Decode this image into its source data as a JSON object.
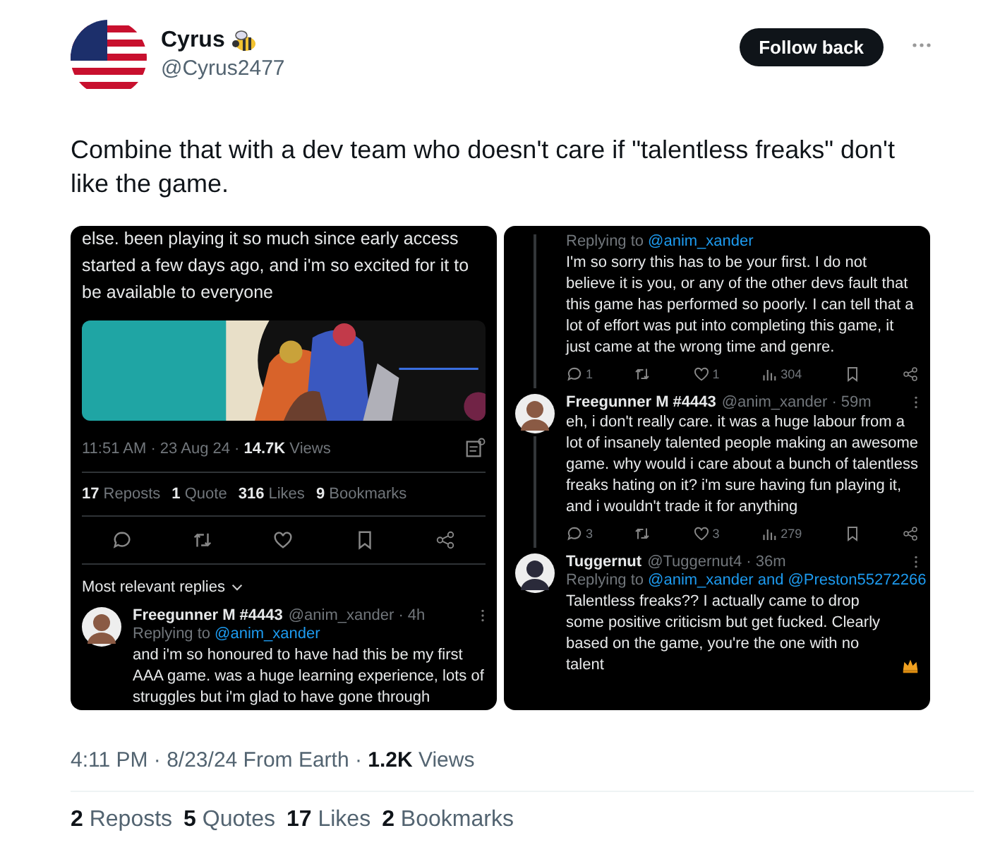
{
  "author": {
    "name": "Cyrus",
    "handle": "@Cyrus2477"
  },
  "follow_button": "Follow back",
  "body": "Combine that with a dev team who doesn't care if \"talentless freaks\" don't like the game.",
  "screenshots": [
    {
      "kind": "post",
      "text": "else. been playing it so much since early access started a few days ago, and i'm so excited for it to be available to everyone",
      "media": {
        "kind": "picture"
      },
      "meta": "11:51 AM · 23 Aug 24 · **14.7K** Views",
      "stats": [
        "**17** Reposts",
        "**1** Quote",
        "**316** Likes",
        "**9** Bookmarks"
      ],
      "actions": [
        {
          "kind": "reply"
        },
        {
          "kind": "repost"
        },
        {
          "kind": "like"
        },
        {
          "kind": "bookmark"
        },
        {
          "kind": "share"
        }
      ],
      "sort_label": "Most relevant replies",
      "replies": [
        {
          "name": "Freegunner M #4443",
          "handle": "@anim_xander · 4h",
          "replying_prefix": "Replying to",
          "mentions": [
            "@anim_xander"
          ],
          "text": "and i'm so honoured to have had this be my first AAA game. was a huge learning experience, lots of struggles but i'm glad to have gone through"
        }
      ]
    },
    {
      "kind": "thread",
      "replies": [
        {
          "replying_prefix": "Replying to",
          "mentions": [
            "@anim_xander"
          ],
          "text": "I'm so sorry this has to be your first. I do not believe it is you, or any of the other devs fault that this game has performed so poorly. I can tell that a lot of effort was put into completing this game, it just came at the wrong time and genre.",
          "actions": [
            {
              "kind": "reply",
              "count": "1"
            },
            {
              "kind": "repost"
            },
            {
              "kind": "like",
              "count": "1"
            },
            {
              "kind": "views",
              "count": "304"
            },
            {
              "kind": "bookmark"
            },
            {
              "kind": "share"
            }
          ]
        },
        {
          "name": "Freegunner M #4443",
          "handle": "@anim_xander · 59m",
          "text": "eh, i don't really care. it was a huge labour from a lot of insanely talented people making an awesome game. why would i care about a bunch of talentless freaks hating on it? i'm sure having fun playing it, and i wouldn't trade it for anything",
          "actions": [
            {
              "kind": "reply",
              "count": "3"
            },
            {
              "kind": "repost"
            },
            {
              "kind": "like",
              "count": "3"
            },
            {
              "kind": "views",
              "count": "279"
            },
            {
              "kind": "bookmark"
            },
            {
              "kind": "share"
            }
          ]
        },
        {
          "name": "Tuggernut",
          "handle": "@Tuggernut4 · 36m",
          "replying_prefix": "Replying to",
          "mentions": [
            "@anim_xander and",
            "@Preston55272266"
          ],
          "text": "Talentless freaks?? I actually came to drop some positive criticism but get fucked. Clearly based on the game, you're the one with no talent",
          "crown_emoji": true
        }
      ]
    }
  ],
  "timestamp": "4:11 PM · 8/23/24 From Earth · **1.2K** Views",
  "stats": [
    "**2** Reposts",
    "**5** Quotes",
    "**17** Likes",
    "**2** Bookmarks"
  ]
}
